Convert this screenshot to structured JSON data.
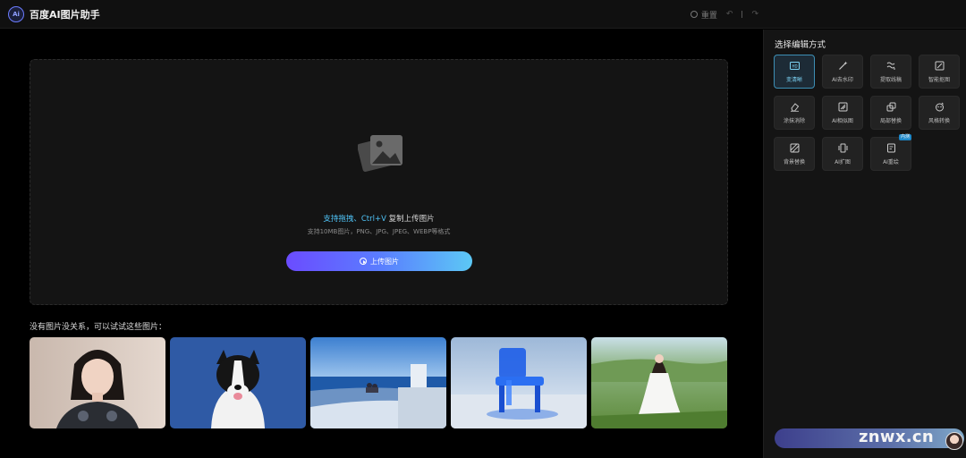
{
  "header": {
    "logo_text": "Ai",
    "app_title": "百度AI图片助手",
    "reset_label": "重置"
  },
  "upload": {
    "hint_accent": "支持拖拽、Ctrl+V",
    "hint_rest": " 复制上传图片",
    "format_hint": "支持10MB图片，PNG、JPG、JPEG、WEBP等格式",
    "button_label": "上传图片"
  },
  "samples": {
    "label": "没有图片没关系，可以试试这些图片：",
    "items": [
      "portrait",
      "dog",
      "seaside",
      "chair",
      "girl-in-field"
    ]
  },
  "sidebar": {
    "title": "选择编辑方式",
    "tools": [
      {
        "label": "变清晰",
        "icon": "hd-icon",
        "active": true
      },
      {
        "label": "AI去水印",
        "icon": "magic-wand-icon"
      },
      {
        "label": "提取线稿",
        "icon": "sketch-icon"
      },
      {
        "label": "智能抠图",
        "icon": "crop-icon"
      },
      {
        "label": "涂抹消除",
        "icon": "eraser-icon"
      },
      {
        "label": "AI相似图",
        "icon": "similar-icon"
      },
      {
        "label": "局部替换",
        "icon": "replace-icon"
      },
      {
        "label": "风格转换",
        "icon": "style-icon"
      },
      {
        "label": "背景替换",
        "icon": "background-icon"
      },
      {
        "label": "AI扩图",
        "icon": "expand-icon"
      },
      {
        "label": "AI重绘",
        "icon": "redraw-icon",
        "badge": "内测"
      }
    ]
  },
  "watermark": "znwx.cn",
  "colors": {
    "accent": "#4fc3f7",
    "button_start": "#6b4cff",
    "button_end": "#5cc8f5",
    "active_border": "#3d8fb5"
  }
}
